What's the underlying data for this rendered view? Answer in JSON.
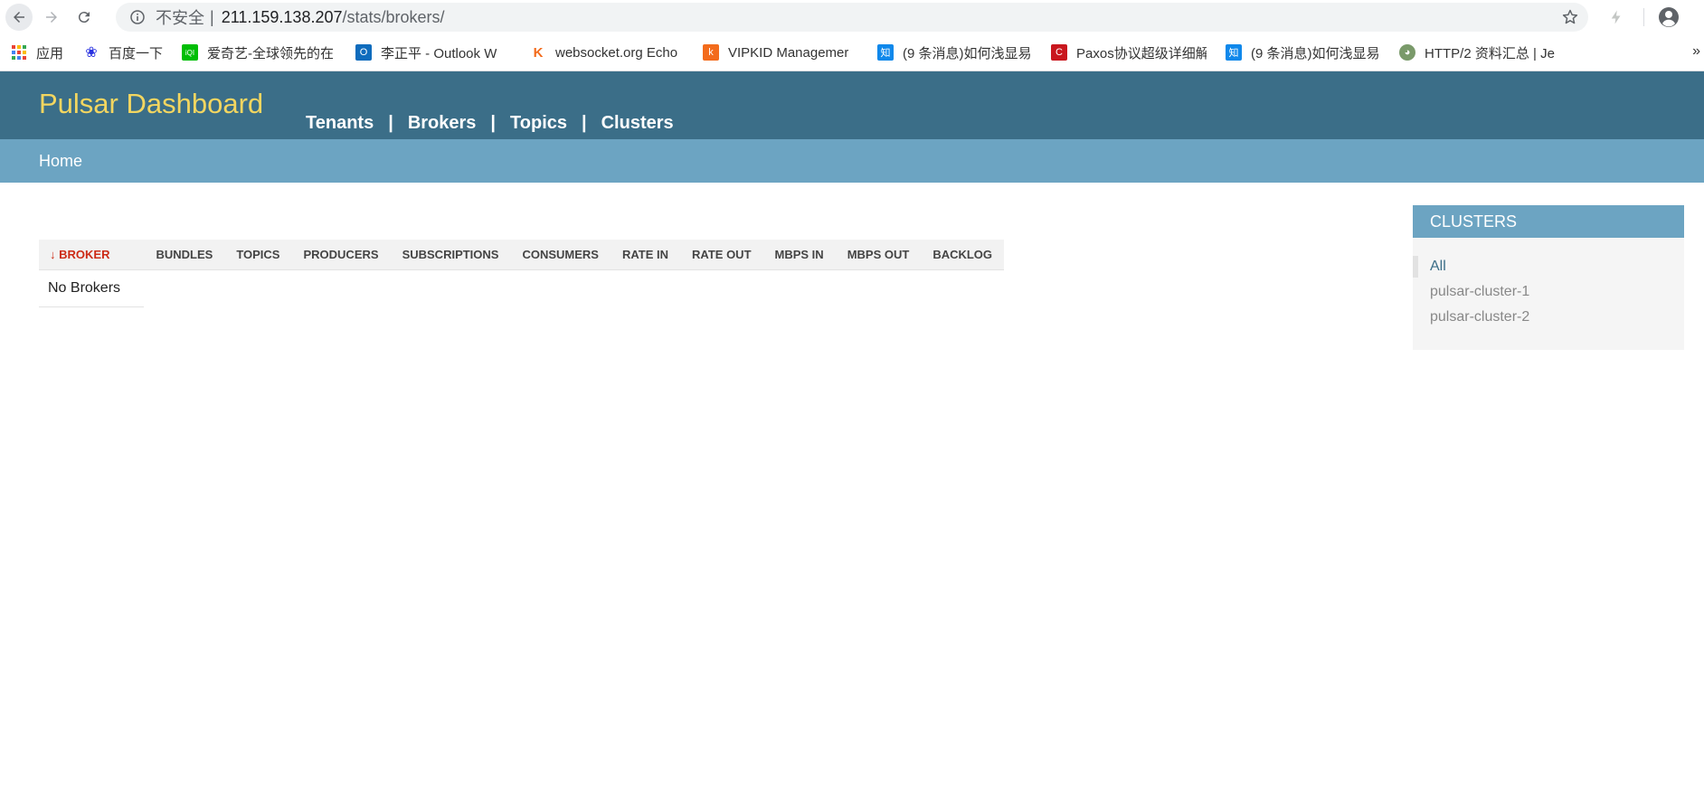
{
  "browser": {
    "insecure_label": "不安全",
    "separator": "|",
    "url_host": "211.159.138.207",
    "url_path": "/stats/brokers/",
    "bookmarks": [
      {
        "label": "应用",
        "icon": "apps-grid-icon",
        "color": "#1a73e8"
      },
      {
        "label": "百度一下",
        "icon": "baidu-paw-icon",
        "color": "#2932e1"
      },
      {
        "label": "爱奇艺-全球领先的在",
        "icon": "iqiyi-icon",
        "color": "#00be06"
      },
      {
        "label": "李正平 - Outlook W",
        "icon": "outlook-icon",
        "color": "#0f6cbd"
      },
      {
        "label": "websocket.org Echo",
        "icon": "websocket-icon",
        "color": "#f36b1c"
      },
      {
        "label": "VIPKID Managemer",
        "icon": "vipkid-icon",
        "color": "#f36b1c"
      },
      {
        "label": "(9 条消息)如何浅显易",
        "icon": "zhihu-icon",
        "color": "#0f88eb"
      },
      {
        "label": "Paxos协议超级详细解",
        "icon": "csdn-icon",
        "color": "#c9171e"
      },
      {
        "label": "(9 条消息)如何浅显易",
        "icon": "zhihu-icon",
        "color": "#0f88eb"
      },
      {
        "label": "HTTP/2 资料汇总 | Je",
        "icon": "avatar-icon",
        "color": "#7a9a6a"
      }
    ],
    "bookmarks_more": "»"
  },
  "header": {
    "brand": "Pulsar Dashboard",
    "nav": [
      "Tenants",
      "Brokers",
      "Topics",
      "Clusters"
    ],
    "pipe": "|"
  },
  "subnav": {
    "home": "Home"
  },
  "table": {
    "sort_arrow": "↓",
    "columns": [
      "BROKER",
      "BUNDLES",
      "TOPICS",
      "PRODUCERS",
      "SUBSCRIPTIONS",
      "CONSUMERS",
      "RATE IN",
      "RATE OUT",
      "MBPS IN",
      "MBPS OUT",
      "BACKLOG"
    ],
    "empty_message": "No Brokers"
  },
  "sidebar": {
    "title": "CLUSTERS",
    "items": [
      "All",
      "pulsar-cluster-1",
      "pulsar-cluster-2"
    ],
    "active_index": 0
  },
  "colors": {
    "header_bg": "#3b6e88",
    "brand_text": "#f3d660",
    "subbar_bg": "#6ca4c2",
    "sort_active": "#cc2b16"
  }
}
